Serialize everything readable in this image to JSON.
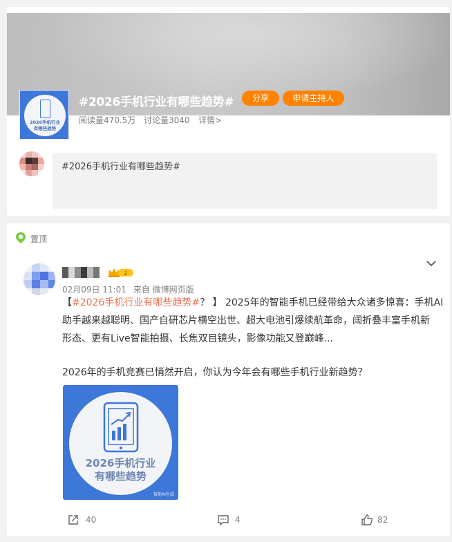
{
  "topic": {
    "title": "#2026手机行业有哪些趋势#",
    "thumb_line1": "2026手机行业",
    "thumb_line2": "有哪些趋势",
    "share_label": "分享",
    "host_label": "申请主持人",
    "reads": "阅读量470.5万",
    "comments": "讨论量3040",
    "details": "详情>",
    "compose_text": "#2026手机行业有哪些趋势#"
  },
  "post": {
    "pinned_label": "置顶",
    "vip_level": "1",
    "date": "02月09日 11:01",
    "source": "来自 微博网页版",
    "line1_prefix": "【",
    "line1_tag": "#2026手机行业有哪些趋势#",
    "line1_rest": "？ 】 2025年的智能手机已经带给大众诸多惊喜：手机AI",
    "line2": "助手越来越聪明、国产自研芯片横空出世、超大电池引爆续航革命，阔折叠丰富手机新",
    "line3": "形态、更有Live智能拍摄、长焦双目镜头，影像功能又登巅峰...",
    "line4": "2026年的手机竞赛已悄然开启，你认为今年会有哪些手机行业新趋势？",
    "image_line1": "2026手机行业",
    "image_line2": "有哪些趋势",
    "image_footer": "智能AI生成",
    "reposts": "40",
    "comments": "4",
    "likes": "82"
  },
  "colors": {
    "accent_orange": "#ff8200",
    "topic_link": "#eb7350",
    "image_blue": "#3d77d8"
  }
}
